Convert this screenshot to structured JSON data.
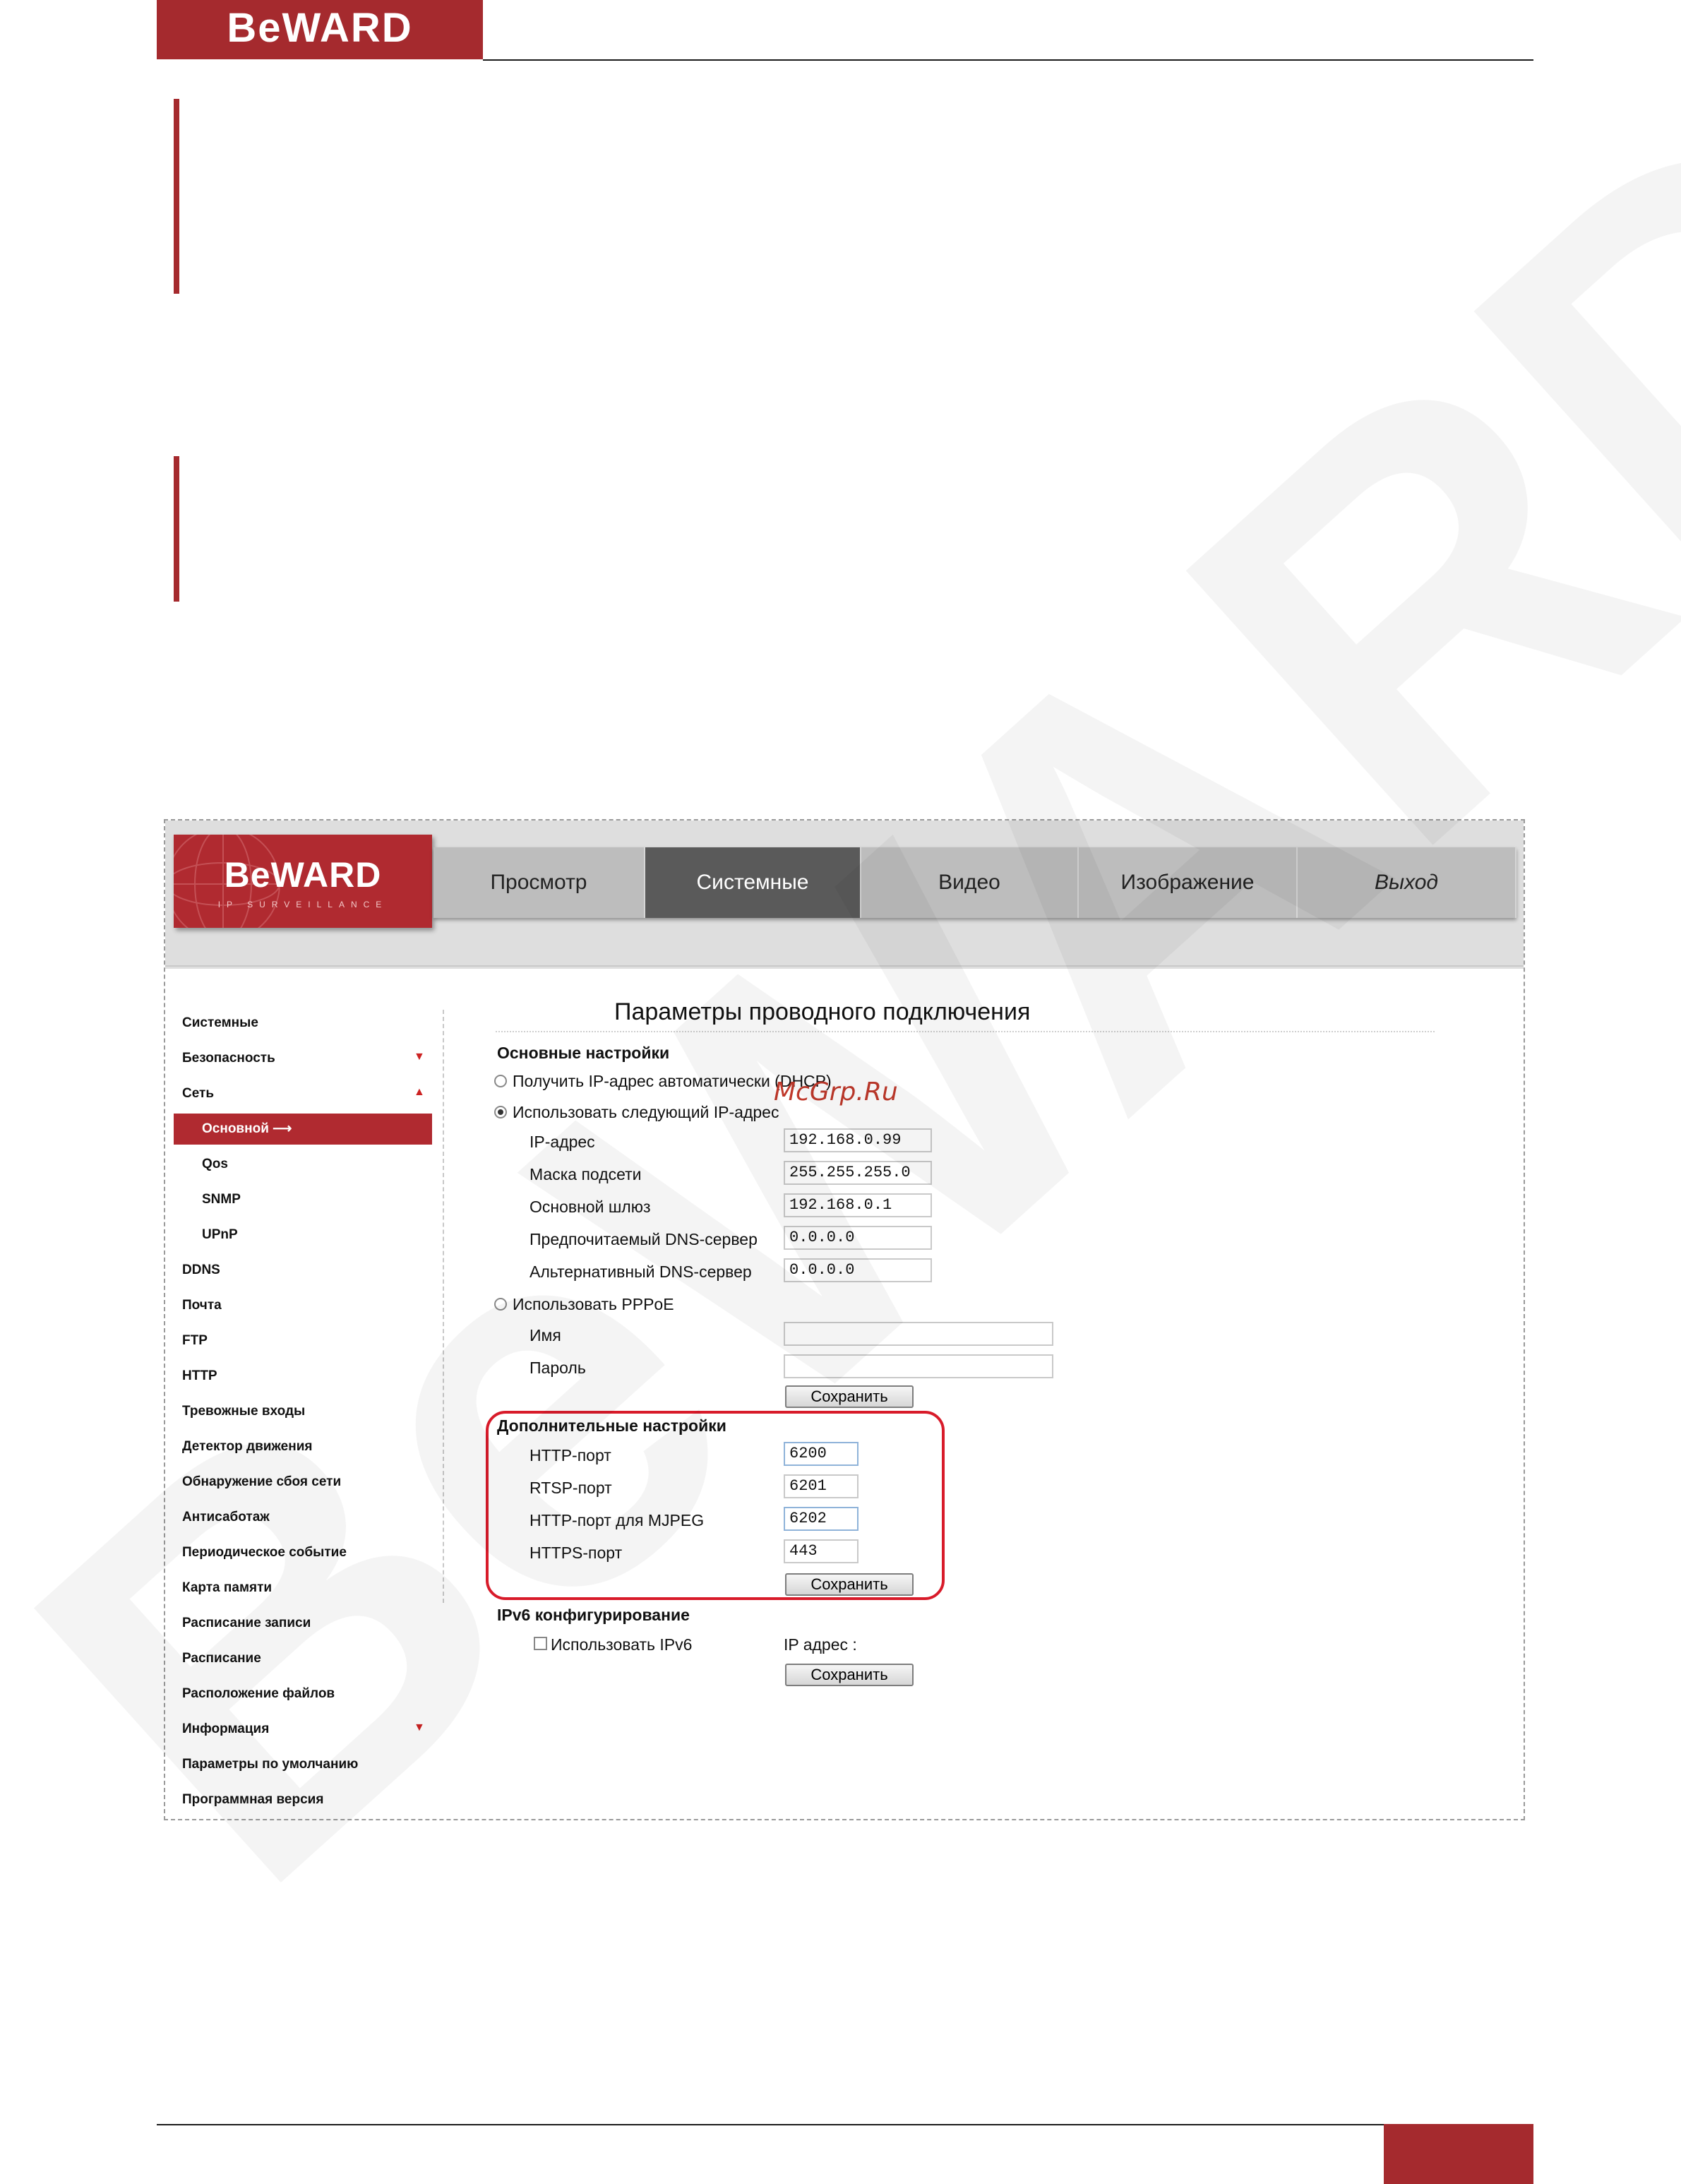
{
  "doc": {
    "logo_text": "BeWARD"
  },
  "cam": {
    "logo_text": "BeWARD",
    "logo_sub": "IP SURVEILLANCE",
    "nav": [
      {
        "label": "Просмотр",
        "active": false,
        "italic": false
      },
      {
        "label": "Системные",
        "active": true,
        "italic": false
      },
      {
        "label": "Видео",
        "active": false,
        "italic": false
      },
      {
        "label": "Изображение",
        "active": false,
        "italic": false
      },
      {
        "label": "Выход",
        "active": false,
        "italic": true
      }
    ],
    "sidebar": [
      {
        "label": "Системные"
      },
      {
        "label": "Безопасность",
        "arrow": "▼"
      },
      {
        "label": "Сеть",
        "arrow": "▲"
      },
      {
        "label": "Основной ⟶",
        "active": true,
        "sub": true
      },
      {
        "label": "Qos",
        "sub": true
      },
      {
        "label": "SNMP",
        "sub": true
      },
      {
        "label": "UPnP",
        "sub": true
      },
      {
        "label": "DDNS"
      },
      {
        "label": "Почта"
      },
      {
        "label": "FTP"
      },
      {
        "label": "HTTP"
      },
      {
        "label": "Тревожные входы"
      },
      {
        "label": "Детектор движения"
      },
      {
        "label": "Обнаружение сбоя сети"
      },
      {
        "label": "Антисаботаж"
      },
      {
        "label": "Периодическое событие"
      },
      {
        "label": "Карта памяти"
      },
      {
        "label": "Расписание записи"
      },
      {
        "label": "Расписание"
      },
      {
        "label": "Расположение файлов"
      },
      {
        "label": "Информация",
        "arrow": "▼"
      },
      {
        "label": "Параметры по умолчанию"
      },
      {
        "label": "Программная версия"
      }
    ],
    "form": {
      "title": "Параметры проводного подключения",
      "basic_section": "Основные настройки",
      "radio_dhcp": "Получить IP-адрес автоматически (DHCP)",
      "radio_static": "Использовать следующий IP-адрес",
      "ip_label": "IP-адрес",
      "ip_value": "192.168.0.99",
      "mask_label": "Маска подсети",
      "mask_value": "255.255.255.0",
      "gateway_label": "Основной шлюз",
      "gateway_value": "192.168.0.1",
      "dns1_label": "Предпочитаемый DNS-сервер",
      "dns1_value": "0.0.0.0",
      "dns2_label": "Альтернативный DNS-сервер",
      "dns2_value": "0.0.0.0",
      "radio_pppoe": "Использовать PPPoE",
      "name_label": "Имя",
      "name_value": "",
      "password_label": "Пароль",
      "password_value": "",
      "save_label": "Сохранить",
      "advanced_section": "Дополнительные настройки",
      "http_port_label": "HTTP-порт",
      "http_port_value": "6200",
      "rtsp_port_label": "RTSP-порт",
      "rtsp_port_value": "6201",
      "mjpeg_port_label": "HTTP-порт для MJPEG",
      "mjpeg_port_value": "6202",
      "https_port_label": "HTTPS-порт",
      "https_port_value": "443",
      "ipv6_section": "IPv6 конфигурирование",
      "ipv6_checkbox_label": "Использовать IPv6",
      "ipv6_address_label": "IP адрес :"
    },
    "overlay_text": "McGrp.Ru"
  },
  "colors": {
    "brand": "#a52a2e",
    "nav_active": "#5a5a5a",
    "highlight": "#d81b2a"
  }
}
